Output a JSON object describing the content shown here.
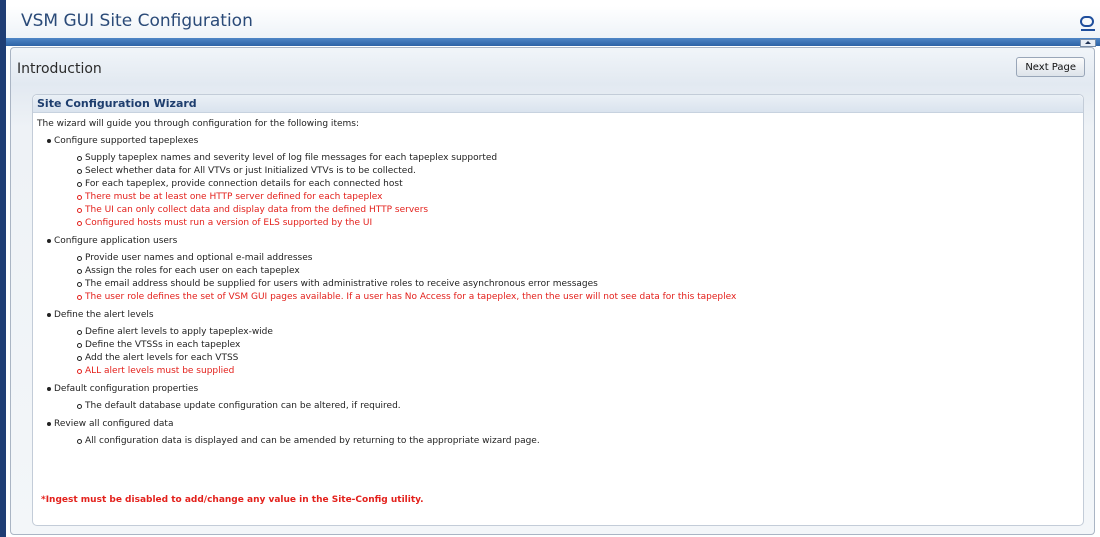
{
  "app": {
    "title": "VSM GUI Site Configuration"
  },
  "panel": {
    "title": "Introduction",
    "next_label": "Next Page"
  },
  "wizard": {
    "title": "Site Configuration Wizard",
    "intro": "The wizard will guide you through configuration for the following items:",
    "sections": [
      {
        "title": "Configure supported tapeplexes",
        "items": [
          {
            "text": "Supply tapeplex names and severity level of log file messages for each tapeplex supported",
            "style": "normal"
          },
          {
            "text": "Select whether data for All VTVs or just Initialized VTVs is to be collected.",
            "style": "normal"
          },
          {
            "text": "For each tapeplex, provide connection details for each connected host",
            "style": "normal"
          },
          {
            "text": "There must be at least one HTTP server defined for each tapeplex",
            "style": "warning"
          },
          {
            "text": "The UI can only collect data and display data from the defined HTTP servers",
            "style": "warning"
          },
          {
            "text": "Configured hosts must run a version of ELS supported by the UI",
            "style": "warning"
          }
        ]
      },
      {
        "title": "Configure application users",
        "items": [
          {
            "text": "Provide user names and optional e-mail addresses",
            "style": "normal"
          },
          {
            "text": "Assign the roles for each user on each tapeplex",
            "style": "normal"
          },
          {
            "text": "The email address should be supplied for users with administrative roles to receive asynchronous error messages",
            "style": "normal"
          },
          {
            "text": "The user role defines the set of VSM GUI pages available. If a user has No Access for a tapeplex, then the user will not see data for this tapeplex",
            "style": "warning"
          }
        ]
      },
      {
        "title": "Define the alert levels",
        "items": [
          {
            "text": "Define alert levels to apply tapeplex-wide",
            "style": "normal"
          },
          {
            "text": "Define the VTSSs in each tapeplex",
            "style": "normal"
          },
          {
            "text": "Add the alert levels for each VTSS",
            "style": "normal"
          },
          {
            "text": "ALL alert levels must be supplied",
            "style": "warning"
          }
        ]
      },
      {
        "title": "Default configuration properties",
        "items": [
          {
            "text": "The default database update configuration can be altered, if required.",
            "style": "normal"
          }
        ]
      },
      {
        "title": "Review all configured data",
        "items": [
          {
            "text": "All configuration data is displayed and can be amended by returning to the appropriate wizard page.",
            "style": "normal"
          }
        ]
      }
    ],
    "warning": "*Ingest must be disabled to add/change any value in the Site-Config utility."
  },
  "colors": {
    "warning": "#e3211c",
    "title": "#1e3e6e",
    "header_band": "#2e63a6"
  }
}
